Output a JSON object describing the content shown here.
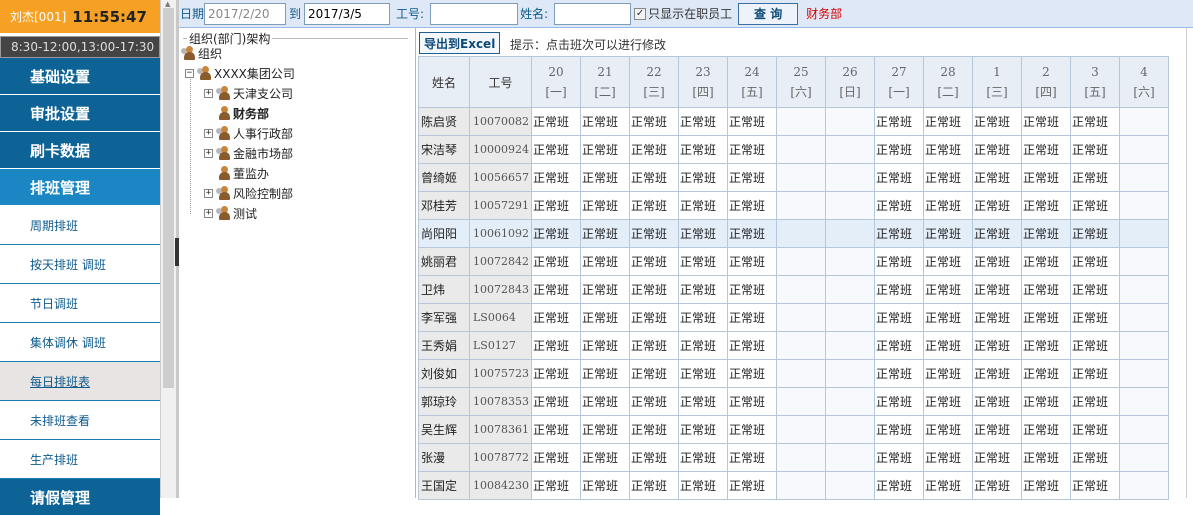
{
  "header": {
    "user": "刘杰[001]",
    "clock": "11:55:47",
    "hours": "8:30-12:00,13:00-17:30"
  },
  "sidebar": {
    "main_menu": [
      "基础设置",
      "审批设置",
      "刷卡数据",
      "排班管理"
    ],
    "sub_menu": [
      "周期排班",
      "按天排班 调班",
      "节日调班",
      "集体调休 调班",
      "每日排班表",
      "未排班查看",
      "生产排班"
    ],
    "bottom_menu": "请假管理"
  },
  "toolbar": {
    "date_label": "日期",
    "date_from": "2017/2/20",
    "date_to_label": "到",
    "date_to": "2017/3/5",
    "emp_id_label": "工号:",
    "emp_id_value": "",
    "name_label": "姓名:",
    "name_value": "",
    "active_only_label": "只显示在职员工",
    "active_only_checked": true,
    "query_button": "查 询",
    "selected_dept": "财务部"
  },
  "tree": {
    "legend": "组织(部门)架构",
    "root": "组织",
    "company": "XXXX集团公司",
    "nodes": [
      "天津支公司",
      "财务部",
      "人事行政部",
      "金融市场部",
      "董监办",
      "风险控制部",
      "测试"
    ]
  },
  "grid": {
    "export_button": "导出到Excel",
    "tip": "提示：点击班次可以进行修改",
    "col_name": "姓名",
    "col_id": "工号",
    "days": [
      {
        "d": "20",
        "w": "[一]"
      },
      {
        "d": "21",
        "w": "[二]"
      },
      {
        "d": "22",
        "w": "[三]"
      },
      {
        "d": "23",
        "w": "[四]"
      },
      {
        "d": "24",
        "w": "[五]"
      },
      {
        "d": "25",
        "w": "[六]"
      },
      {
        "d": "26",
        "w": "[日]"
      },
      {
        "d": "27",
        "w": "[一]"
      },
      {
        "d": "28",
        "w": "[二]"
      },
      {
        "d": "1",
        "w": "[三]"
      },
      {
        "d": "2",
        "w": "[四]"
      },
      {
        "d": "3",
        "w": "[五]"
      },
      {
        "d": "4",
        "w": "[六]"
      }
    ],
    "shift": "正常班",
    "rows": [
      {
        "name": "陈启贤",
        "id": "10070082"
      },
      {
        "name": "宋洁琴",
        "id": "10000924"
      },
      {
        "name": "曾绮姬",
        "id": "10056657"
      },
      {
        "name": "邓桂芳",
        "id": "10057291"
      },
      {
        "name": "尚阳阳",
        "id": "10061092"
      },
      {
        "name": "姚丽君",
        "id": "10072842"
      },
      {
        "name": "卫炜",
        "id": "10072843"
      },
      {
        "name": "李军强",
        "id": "LS0064"
      },
      {
        "name": "王秀娟",
        "id": "LS0127"
      },
      {
        "name": "刘俊如",
        "id": "10075723"
      },
      {
        "name": "郭琼玲",
        "id": "10078353"
      },
      {
        "name": "吴生辉",
        "id": "10078361"
      },
      {
        "name": "张漫",
        "id": "10078772"
      },
      {
        "name": "王国定",
        "id": "10084230"
      }
    ],
    "highlighted_row": 4
  },
  "colors": {
    "accent_orange": "#f6a123",
    "menu_blue": "#0d6396",
    "menu_active": "#1a87c4",
    "dept_red": "#d40000"
  }
}
